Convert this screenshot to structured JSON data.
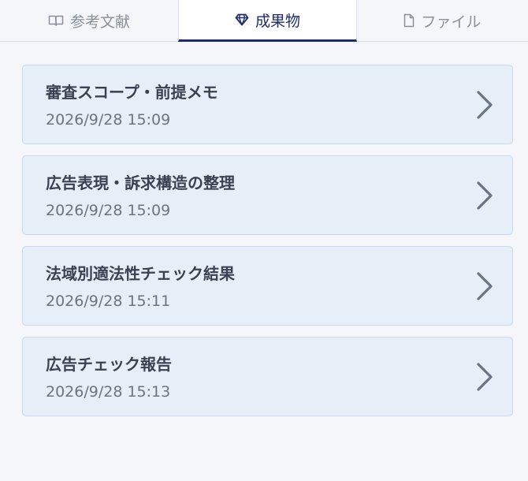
{
  "tabs": [
    {
      "label": "参考文献",
      "icon": "book-icon",
      "active": false
    },
    {
      "label": "成果物",
      "icon": "diamond-icon",
      "active": true
    },
    {
      "label": "ファイル",
      "icon": "file-icon",
      "active": false
    }
  ],
  "items": [
    {
      "title": "審査スコープ・前提メモ",
      "timestamp": "2026/9/28 15:09"
    },
    {
      "title": "広告表現・訴求構造の整理",
      "timestamp": "2026/9/28 15:09"
    },
    {
      "title": "法域別適法性チェック結果",
      "timestamp": "2026/9/28 15:11"
    },
    {
      "title": "広告チェック報告",
      "timestamp": "2026/9/28 15:13"
    }
  ],
  "colors": {
    "accent": "#1f2d6b",
    "card_bg": "#e6eef8",
    "card_border": "#c9d8ec",
    "page_bg": "#f4f6f9"
  }
}
